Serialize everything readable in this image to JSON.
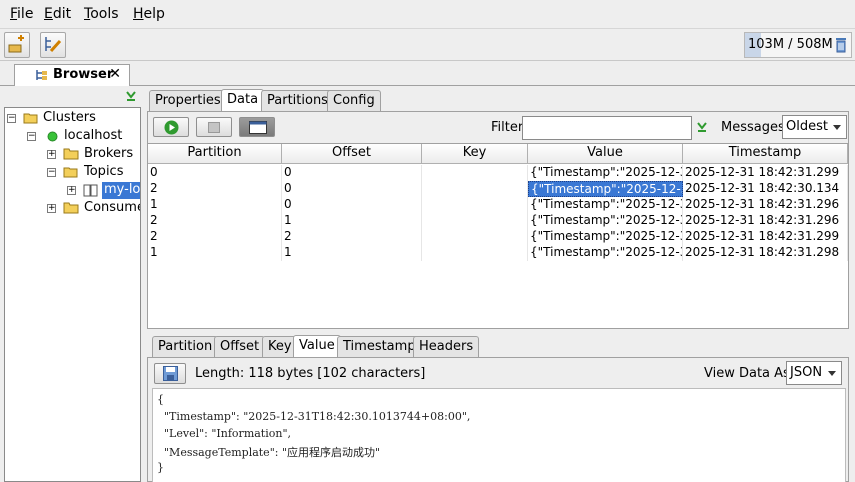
{
  "menu": {
    "items": [
      {
        "mnemonic": "F",
        "rest": "ile"
      },
      {
        "mnemonic": "E",
        "rest": "dit"
      },
      {
        "mnemonic": "T",
        "rest": "ools"
      },
      {
        "mnemonic": "H",
        "rest": "elp"
      }
    ]
  },
  "toolbar": {
    "memory": "103M / 508M"
  },
  "main_tab": {
    "label": "Browser",
    "close": "✕"
  },
  "tree": {
    "nodes": [
      {
        "label": "Clusters",
        "exp": "−"
      },
      {
        "label": "localhost",
        "exp": "−"
      },
      {
        "label": "Brokers",
        "exp": "+"
      },
      {
        "label": "Topics",
        "exp": "−"
      },
      {
        "label": "my-log",
        "exp": "+"
      },
      {
        "label": "Consumers",
        "exp": "+"
      }
    ]
  },
  "tabs": [
    "Properties",
    "Data",
    "Partitions",
    "Config"
  ],
  "active_tab": "Data",
  "data_toolbar": {
    "filter_label": "Filter",
    "filter_value": "",
    "messages_label": "Messages",
    "messages_value": "Oldest"
  },
  "table": {
    "columns": [
      "Partition",
      "Offset",
      "Key",
      "Value",
      "Timestamp"
    ],
    "rows": [
      [
        "0",
        "0",
        "",
        "{\"Timestamp\":\"2025-12-3...",
        "2025-12-31 18:42:31.299"
      ],
      [
        "2",
        "0",
        "",
        "{\"Timestamp\":\"2025-12-3...",
        "2025-12-31 18:42:30.134"
      ],
      [
        "1",
        "0",
        "",
        "{\"Timestamp\":\"2025-12-3...",
        "2025-12-31 18:42:31.296"
      ],
      [
        "2",
        "1",
        "",
        "{\"Timestamp\":\"2025-12-3...",
        "2025-12-31 18:42:31.296"
      ],
      [
        "2",
        "2",
        "",
        "{\"Timestamp\":\"2025-12-3...",
        "2025-12-31 18:42:31.299"
      ],
      [
        "1",
        "1",
        "",
        "{\"Timestamp\":\"2025-12-3...",
        "2025-12-31 18:42:31.298"
      ]
    ]
  },
  "detail_tabs": [
    "Partition",
    "Offset",
    "Key",
    "Value",
    "Timestamp",
    "Headers"
  ],
  "active_detail_tab": "Value",
  "detail": {
    "length_label": "Length: 118 bytes [102 characters]",
    "view_label": "View Data As",
    "view_value": "JSON",
    "json_lines": [
      "{",
      "  \"Timestamp\": \"2025-12-31T18:42:30.1013744+08:00\",",
      "  \"Level\": \"Information\",",
      "  \"MessageTemplate\": \"应用程序启动成功\"",
      "}"
    ]
  },
  "colors": {
    "selection": "#3a78d4",
    "play_green": "#2f9a2f",
    "status_green": "#38c238",
    "folder_yellow": "#f3cf5a"
  }
}
